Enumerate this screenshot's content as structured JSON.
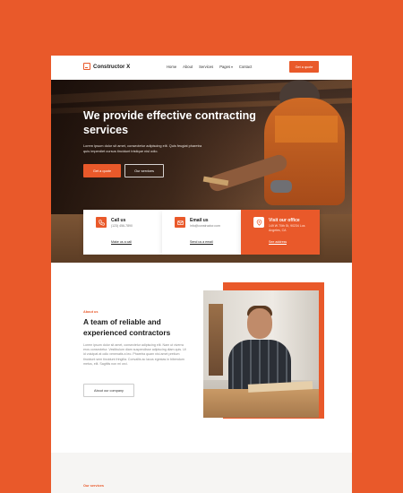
{
  "colors": {
    "accent": "#e9592a",
    "background": "#e9592a",
    "dark": "#1a1a1a"
  },
  "nav": {
    "logo_icon": "logo-square-icon",
    "logo_text": "Constructor X",
    "items": [
      {
        "label": "Home"
      },
      {
        "label": "About"
      },
      {
        "label": "Services"
      },
      {
        "label": "Pages",
        "caret": "▾"
      },
      {
        "label": "Contact"
      }
    ],
    "cta": "Get a quote"
  },
  "hero": {
    "title": "We provide effective contracting services",
    "text": "Lorem ipsum dolor sit amet, consectetur adipiscing elit. Quis feugiat pharetra quis imperdiet cursus tincidunt tristique nisl odio.",
    "primary_button": "Get a quote",
    "secondary_button": "Our services"
  },
  "contact_cards": [
    {
      "icon": "phone-icon",
      "title": "Call us",
      "sub": "(123) 456-7890",
      "link": "Make us a call"
    },
    {
      "icon": "mail-icon",
      "title": "Email us",
      "sub": "info@constructor.com",
      "link": "Send us a email"
    },
    {
      "icon": "location-pin-icon",
      "title": "Visit our office",
      "sub": "149 W 70th St, 90234 Los Angeles, CA",
      "link": "See address"
    }
  ],
  "about": {
    "kicker": "About us",
    "title": "A team of reliable and experienced contractors",
    "text": "Lorem ipsum dolor sit amet, consectetur adipiscing elit. Nam ut viverra eros consectetur. Vestibulum diam suspendisse adipiscing diam quis. Ut id volutpat at odio venenatis a leo. Pharetra quam nisi amet pretium tincidunt sem tincidunt fringilla. Convallis ac lacus egestas in bibendum metus, elit. Sagittis non mi orci.",
    "button": "About our company",
    "photo_icon": "contractor-photo"
  },
  "services": {
    "kicker": "Our services"
  }
}
